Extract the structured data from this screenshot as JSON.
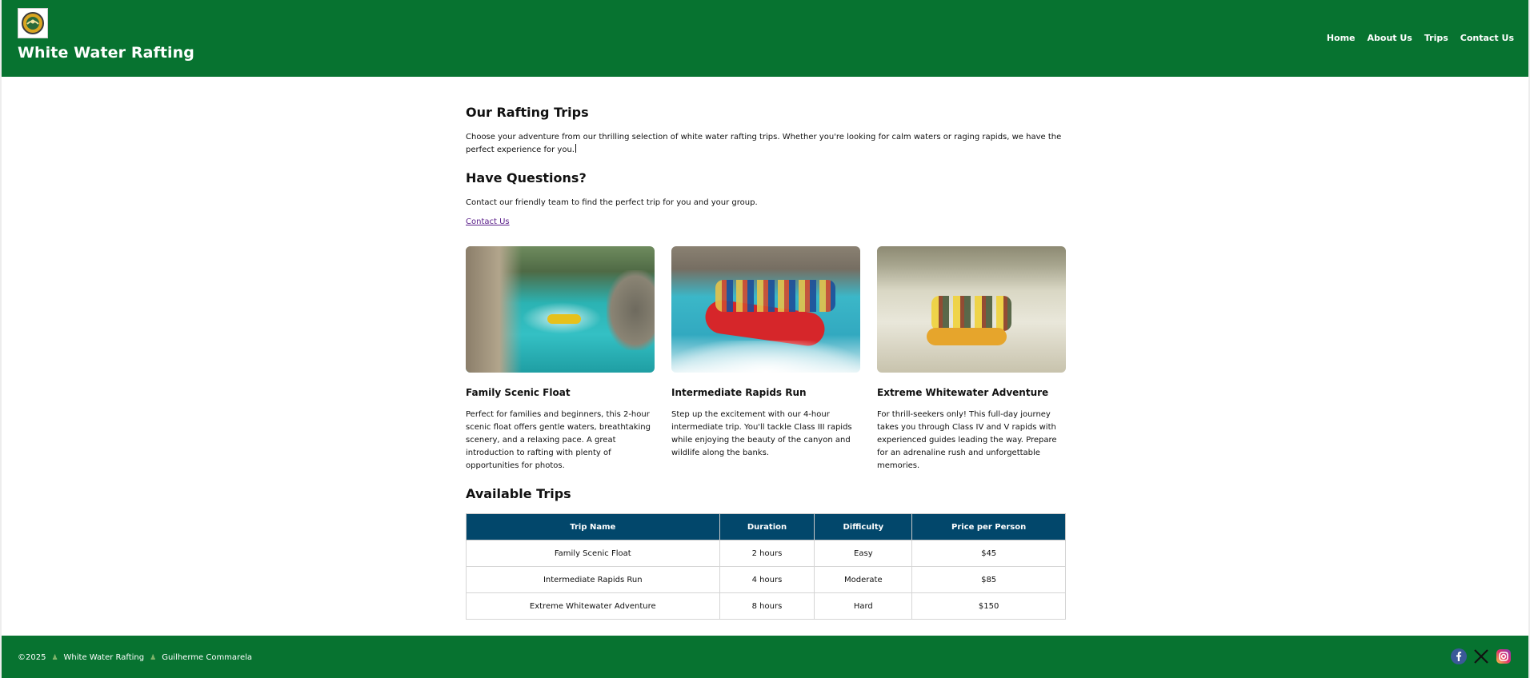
{
  "header": {
    "site_title": "White Water Rafting",
    "logo_icon": "rafting-logo-icon",
    "nav": [
      "Home",
      "About Us",
      "Trips",
      "Contact Us"
    ]
  },
  "intro": {
    "title": "Our Rafting Trips",
    "text": "Choose your adventure from our thrilling selection of white water rafting trips. Whether you're looking for calm waters or raging rapids, we have the perfect experience for you."
  },
  "questions": {
    "title": "Have Questions?",
    "text": "Contact our friendly team to find the perfect trip for you and your group.",
    "link": "Contact Us"
  },
  "cards": [
    {
      "title": "Family Scenic Float",
      "desc": "Perfect for families and beginners, this 2-hour scenic float offers gentle waters, breathtaking scenery, and a relaxing pace. A great introduction to rafting with plenty of opportunities for photos."
    },
    {
      "title": "Intermediate Rapids Run",
      "desc": "Step up the excitement with our 4-hour intermediate trip. You'll tackle Class III rapids while enjoying the beauty of the canyon and wildlife along the banks."
    },
    {
      "title": "Extreme Whitewater Adventure",
      "desc": "For thrill-seekers only! This full-day journey takes you through Class IV and V rapids with experienced guides leading the way. Prepare for an adrenaline rush and unforgettable memories."
    }
  ],
  "available": {
    "title": "Available Trips",
    "columns": [
      "Trip Name",
      "Duration",
      "Difficulty",
      "Price per Person"
    ],
    "rows": [
      [
        "Family Scenic Float",
        "2 hours",
        "Easy",
        "$45"
      ],
      [
        "Intermediate Rapids Run",
        "4 hours",
        "Moderate",
        "$85"
      ],
      [
        "Extreme Whitewater Adventure",
        "8 hours",
        "Hard",
        "$150"
      ]
    ]
  },
  "footer": {
    "copyright": "©2025",
    "site": "White Water Rafting",
    "author": "Guilherme Commarela",
    "separator": "♟",
    "social": [
      "facebook-icon",
      "x-icon",
      "instagram-icon"
    ]
  },
  "colors": {
    "brand_green": "#077330",
    "table_header": "#02476b",
    "link_purple": "#5a1e8a"
  }
}
